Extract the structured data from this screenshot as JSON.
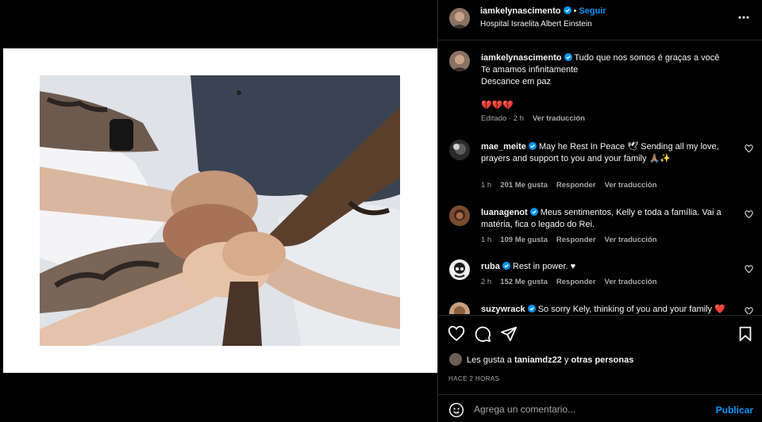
{
  "post": {
    "author": "iamkelynascimento",
    "follow_label": "Seguir",
    "location": "Hospital Israelita Albert Einstein",
    "caption_lines": [
      "Tudo que nos somos é graças a você",
      "Te amamos infinitamente",
      "Descance em paz"
    ],
    "caption_emojis": "💔💔💔",
    "caption_meta": {
      "edited": "Editado · 2 h",
      "translate": "Ver traducción"
    }
  },
  "comments": [
    {
      "user": "mae_meite",
      "text": "May he Rest In Peace 🕊 Sending all my love, prayers and support to you and your family 🙏🏽✨",
      "time": "1 h",
      "likes": "201 Me gusta",
      "reply": "Responder",
      "translate": "Ver traducción"
    },
    {
      "user": "luanagenot",
      "text": "Meus sentimentos, Kelly e toda a família. Vai a matéria, fica o legado do Rei.",
      "time": "1 h",
      "likes": "109 Me gusta",
      "reply": "Responder",
      "translate": "Ver traducción"
    },
    {
      "user": "ruba",
      "text": "Rest in power. ♥",
      "time": "2 h",
      "likes": "152 Me gusta",
      "reply": "Responder",
      "translate": "Ver traducción"
    },
    {
      "user": "suzywrack",
      "text": "So sorry Kely, thinking of you and your family ❤️"
    }
  ],
  "likes": {
    "prefix": "Les gusta a",
    "user": "taniamdz22",
    "joiner": "y",
    "others": "otras personas"
  },
  "posted_time": "HACE 2 HORAS",
  "composer": {
    "placeholder": "Agrega un comentario...",
    "post_label": "Publicar"
  },
  "icons": {
    "more": "more-horizontal-icon",
    "like": "heart-outline-icon",
    "comment": "comment-icon",
    "share": "send-icon",
    "save": "bookmark-icon",
    "emoji": "emoji-icon",
    "verified": "verified-badge-icon"
  },
  "colors": {
    "accent": "#0095f6",
    "background": "#000000",
    "muted": "#a8a8a8",
    "verified": "#0095f6"
  }
}
